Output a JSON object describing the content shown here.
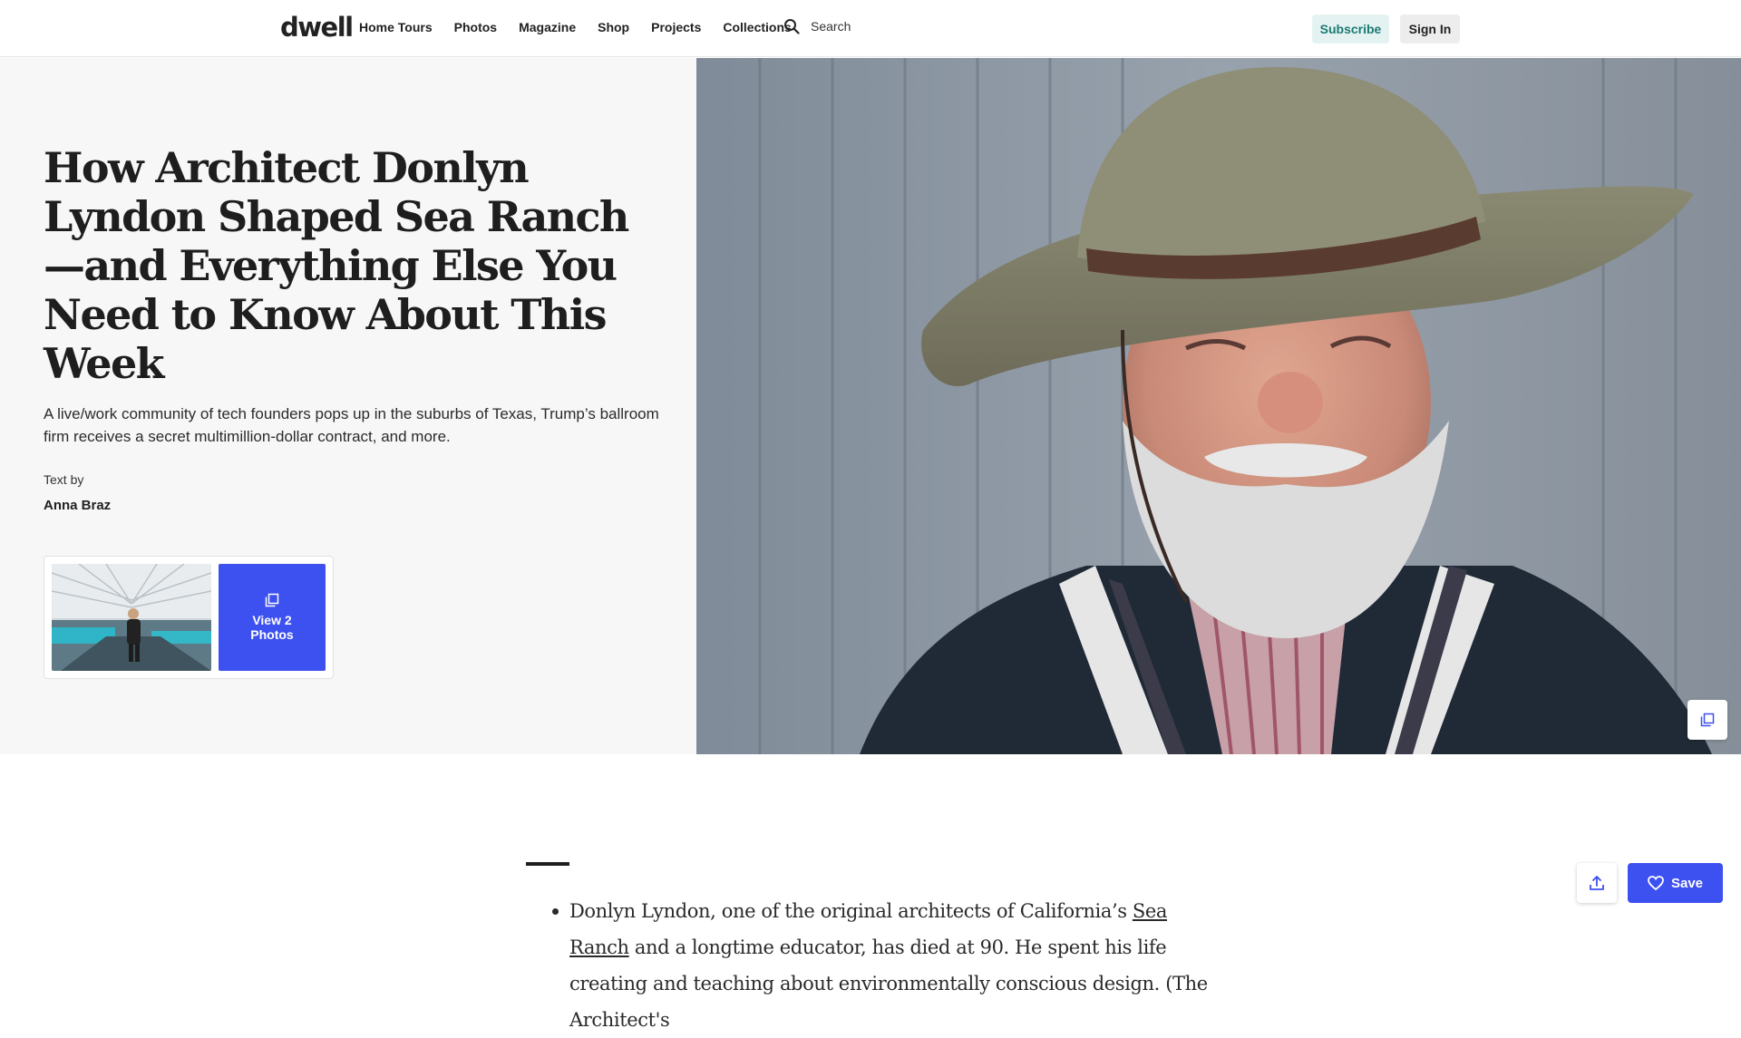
{
  "nav": {
    "logo": "dwell",
    "links": [
      "Home Tours",
      "Photos",
      "Magazine",
      "Shop",
      "Projects",
      "Collections"
    ],
    "search_label": "Search",
    "subscribe_label": "Subscribe",
    "signin_label": "Sign In"
  },
  "article": {
    "headline": "How Architect Donlyn Lyndon Shaped Sea Ranch—and Everything Else You Need to Know About This Week",
    "dek": "A live/work community of tech founders pops up in the suburbs of Texas, Trump’s ballroom firm receives a secret multimillion-dollar contract, and more.",
    "byline_label": "Text by",
    "author": "Anna Braz",
    "gallery_button_label": "View 2 Photos",
    "body_bullet_before_link": "Donlyn Lyndon, one of the original architects of California’s ",
    "body_bullet_link": "Sea Ranch",
    "body_bullet_after_link": " and a longtime educator, has died at 90. He spent his life creating and teaching about environmentally conscious design. (The Architect's"
  },
  "actions": {
    "save_label": "Save"
  },
  "colors": {
    "accent_blue": "#3d50f0",
    "subscribe_bg": "#e4f3f2",
    "subscribe_text": "#1b7a72",
    "hero_left_bg": "#f7f7f7"
  },
  "icons": {
    "search": "search-icon",
    "gallery": "copy-icon",
    "share": "share-icon",
    "save": "heart-icon"
  }
}
